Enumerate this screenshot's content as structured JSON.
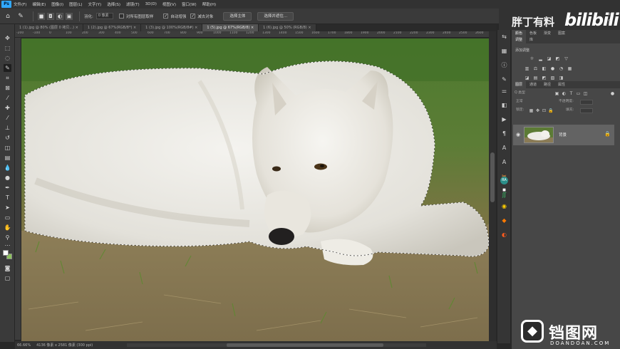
{
  "app": {
    "logo": "Ps"
  },
  "menu": [
    "文件(F)",
    "编辑(E)",
    "图像(I)",
    "图层(L)",
    "文字(Y)",
    "选择(S)",
    "滤镜(T)",
    "3D(D)",
    "视图(V)",
    "窗口(W)",
    "帮助(H)"
  ],
  "options": {
    "feather_label": "羽化:",
    "feather_value": "0 像素",
    "sample_all_label": "对所有图层取样",
    "auto_enhance_label": "自动增强",
    "subtract_label": "减去对象",
    "select_subject_button": "选择主体",
    "select_mask_button": "选择并遮住..."
  },
  "branding": {
    "text": "胖丁有料",
    "logo": "bilibili"
  },
  "tabs": [
    {
      "label": "1 (1).jpg @ 80% (图层 0 拷贝...) × ",
      "active": false
    },
    {
      "label": "1 (2).jpg @ 67%(RGB/8*) × ",
      "active": false
    },
    {
      "label": "1 (3).jpg @ 100%(RGB/8#) × ",
      "active": false
    },
    {
      "label": "1 (5).jpg @ 67%(RGB/8) × ",
      "active": true
    },
    {
      "label": "1 (6).jpg @ 50% (RGB/8) × ",
      "active": false
    }
  ],
  "ruler_ticks": [
    "-200",
    "-100",
    "0",
    "100",
    "200",
    "300",
    "400",
    "500",
    "600",
    "700",
    "800",
    "900",
    "1000",
    "1100",
    "1200",
    "1300",
    "1400",
    "1500",
    "1600",
    "1700",
    "1800",
    "1900",
    "2000",
    "2100",
    "2200",
    "2300",
    "2400",
    "2500",
    "2600"
  ],
  "status": {
    "zoom": "66.66%",
    "doc_info": "4136 像素 x 2581 像素 (300 ppi)"
  },
  "panels": {
    "top_tabs": [
      "颜色",
      "色板",
      "渐变",
      "图案"
    ],
    "adjust_tabs": [
      "调整",
      "库"
    ],
    "adjust_heading": "添加调整",
    "layer_tabs": [
      "图层",
      "通道",
      "路径",
      "属性"
    ],
    "kind_label": "Q 类型",
    "blend_mode": "正常",
    "opacity_label": "不透明度:",
    "lock_label": "锁定:",
    "fill_label": "填充:",
    "layer_name": "背景"
  },
  "watermark": {
    "text": "铛图网",
    "sub": "DOANDOAN.COM"
  }
}
